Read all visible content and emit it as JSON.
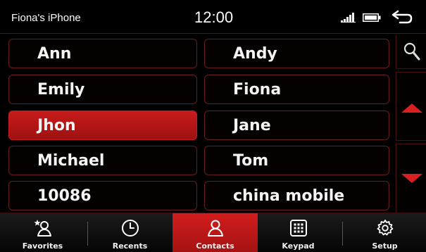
{
  "status": {
    "device_name": "Fiona's iPhone",
    "time": "12:00"
  },
  "contacts": [
    {
      "name": "Ann",
      "selected": false
    },
    {
      "name": "Andy",
      "selected": false
    },
    {
      "name": "Emily",
      "selected": false
    },
    {
      "name": "Fiona",
      "selected": false
    },
    {
      "name": "Jhon",
      "selected": true
    },
    {
      "name": "Jane",
      "selected": false
    },
    {
      "name": "Michael",
      "selected": false
    },
    {
      "name": "Tom",
      "selected": false
    },
    {
      "name": "10086",
      "selected": false
    },
    {
      "name": "china mobile",
      "selected": false
    }
  ],
  "tabs": [
    {
      "label": "Favorites",
      "icon": "favorites-icon",
      "active": false
    },
    {
      "label": "Recents",
      "icon": "clock-icon",
      "active": false
    },
    {
      "label": "Contacts",
      "icon": "contacts-icon",
      "active": true
    },
    {
      "label": "Keypad",
      "icon": "keypad-icon",
      "active": false
    },
    {
      "label": "Setup",
      "icon": "gear-icon",
      "active": false
    }
  ],
  "colors": {
    "accent": "#c81b1b",
    "background": "#000000",
    "border": "#6a1d1d"
  }
}
